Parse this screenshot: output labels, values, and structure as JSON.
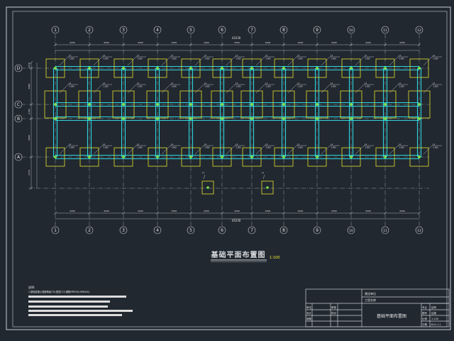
{
  "drawing": {
    "title": "基础平面布置图",
    "scale": "1:100",
    "overall_dimension": "43230",
    "side_dims_left": [
      "2370",
      "4800",
      "2100",
      "4800",
      "2370"
    ],
    "bay_dims_top": [
      "4200",
      "4200",
      "4200",
      "4200",
      "4200",
      "4200",
      "4200",
      "4200",
      "4200",
      "4200",
      "4200"
    ],
    "bay_dims_bottom": [
      "4200",
      "4200",
      "4200",
      "4200",
      "4200",
      "4200",
      "4200",
      "4200",
      "4200",
      "4200",
      "4200"
    ],
    "foundation_tag": "J-1",
    "foundation_elev": "-1.800"
  },
  "axes": {
    "columns": [
      "1",
      "2",
      "3",
      "4",
      "5",
      "6",
      "7",
      "8",
      "9",
      "10",
      "11",
      "12"
    ],
    "rows": [
      "D",
      "C",
      "B",
      "A"
    ]
  },
  "notes": {
    "heading": "说明:",
    "line1": "1.基础混凝土强度等级C30,垫层C15,钢筋HPB300,HRB400。"
  },
  "title_block": {
    "design_unit": "建设单位",
    "project_name": "工程名称",
    "sheet_title": "基础平面布置图",
    "role_a": "审定",
    "role_b": "审核",
    "role_c": "设计",
    "role_d": "校对",
    "role_e": "制图",
    "field_no_label": "图号",
    "field_no_value": "结施",
    "field_scale_label": "比例",
    "field_scale_value": "1:100",
    "field_date_label": "日期",
    "field_date_value": "2011.1.1",
    "field_x_label": "专业",
    "field_x_value": "结构"
  }
}
